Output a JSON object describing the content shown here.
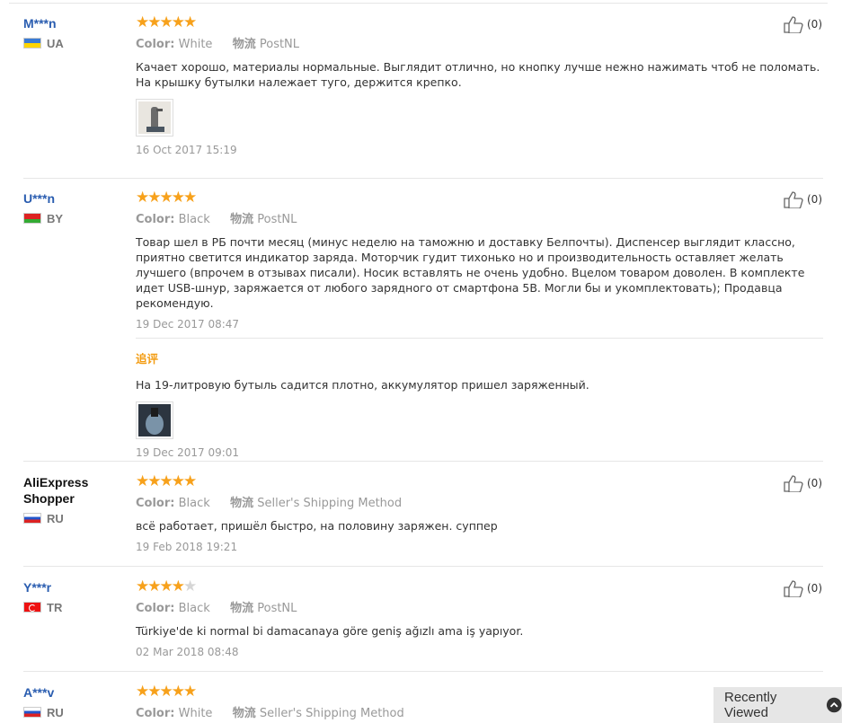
{
  "labels": {
    "color": "Color:",
    "shipping": "物流"
  },
  "reviews": [
    {
      "user": "M***n",
      "country": "UA",
      "stars": 5,
      "color": "White",
      "shipping": "PostNL",
      "text": "Качает хорошо, материалы нормальные. Выглядит отлично, но кнопку лучше нежно нажимать чтоб не поломать. На крышку бутылки належает туго, держится крепко.",
      "date": "16 Oct 2017 15:19",
      "helpful": "(0)"
    },
    {
      "user": "U***n",
      "country": "BY",
      "stars": 5,
      "color": "Black",
      "shipping": "PostNL",
      "text": "Товар шел в РБ почти месяц (минус неделю на таможню и доставку Белпочты). Диспенсер выглядит классно, приятно светится индикатор заряда. Моторчик гудит тихонько но и производительность оставляет желать лучшего (впрочем в отзывах писали). Носик вставлять не очень удобно. Вцелом товаром доволен. В комплекте идет USB-шнур, заряжается от любого зарядного от смартфона 5В. Могли бы и укомплектовать); Продавца рекомендую.",
      "date": "19 Dec 2017 08:47",
      "helpful": "(0)",
      "additional": {
        "label": "追评",
        "text": "На 19-литровую бутыль садится плотно, аккумулятор пришел заряженный.",
        "date": "19 Dec 2017 09:01"
      }
    },
    {
      "user": "AliExpress Shopper",
      "country": "RU",
      "stars": 5,
      "color": "Black",
      "shipping": "Seller's Shipping Method",
      "text": "всё работает, пришёл быстро, на половину заряжен. суппер",
      "date": "19 Feb 2018 19:21",
      "helpful": "(0)"
    },
    {
      "user": "Y***r",
      "country": "TR",
      "stars": 4,
      "color": "Black",
      "shipping": "PostNL",
      "text": "Türkiye'de ki normal bi damacanaya göre geniş ağızlı ama iş yapıyor.",
      "date": "02 Mar 2018 08:48",
      "helpful": "(0)"
    },
    {
      "user": "A***v",
      "country": "RU",
      "stars": 5,
      "color": "White",
      "shipping": "Seller's Shipping Method"
    }
  ],
  "recently_viewed": "Recently Viewed",
  "colors": {
    "star": "#f7a11b",
    "link": "#2a5db0",
    "additional": "#f39c12"
  }
}
